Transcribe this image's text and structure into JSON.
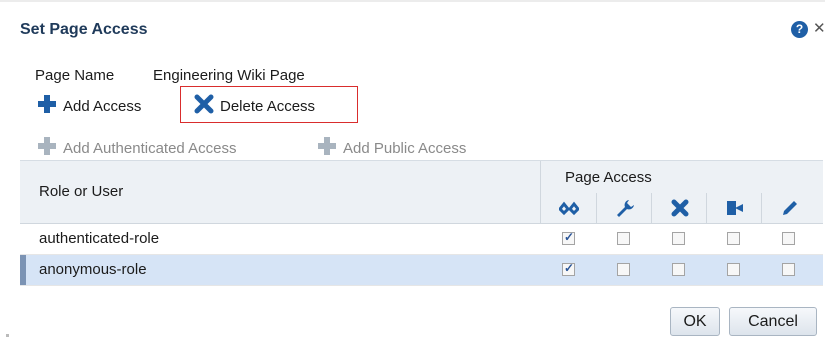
{
  "dialog": {
    "title": "Set Page Access",
    "help_icon": "help-icon",
    "close_icon": "close-icon"
  },
  "page_name": {
    "label": "Page Name",
    "value": "Engineering Wiki Page"
  },
  "toolbar": {
    "add_access": "Add Access",
    "delete_access": "Delete Access",
    "add_authenticated_access": "Add Authenticated Access",
    "add_public_access": "Add Public Access"
  },
  "table": {
    "col_role": "Role or User",
    "col_page_access": "Page Access",
    "permission_icons": [
      "view-icon",
      "manage-icon",
      "delete-icon",
      "edit-icon",
      "pencil-icon"
    ],
    "rows": [
      {
        "name": "authenticated-role",
        "perms": [
          true,
          false,
          false,
          false,
          false
        ],
        "selected": false
      },
      {
        "name": "anonymous-role",
        "perms": [
          true,
          false,
          false,
          false,
          false
        ],
        "selected": true
      }
    ]
  },
  "buttons": {
    "ok": "OK",
    "cancel": "Cancel"
  },
  "colors": {
    "accent": "#1f5fa6",
    "highlight_border": "#d92d2d",
    "selected_row": "#d6e4f6"
  }
}
